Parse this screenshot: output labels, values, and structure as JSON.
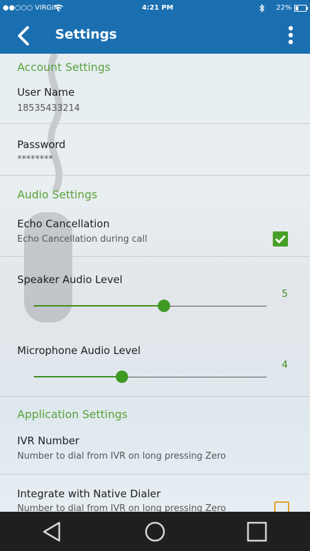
{
  "status": {
    "carrier": "●●○○○ VIRGIN",
    "time": "4:21 PM",
    "battery": "22%",
    "icons": [
      "wifi-icon",
      "bluetooth-icon",
      "battery-icon"
    ]
  },
  "appbar": {
    "title": "Settings",
    "back_icon": "arrow-back-icon",
    "menu_icon": "more-vert-icon"
  },
  "sections": {
    "account": "Account Settings",
    "audio": "Audio Settings",
    "application": "Application Settings"
  },
  "account": {
    "username_label": "User Name",
    "username_value": "18535433214",
    "password_label": "Password",
    "password_value": "********"
  },
  "audio": {
    "echo_label": "Echo Cancellation",
    "echo_sub": "Echo Cancellation during call",
    "echo_checked": true,
    "speaker_label": "Speaker Audio Level",
    "speaker_value": "5",
    "speaker_fraction": 0.56,
    "mic_label": "Microphone Audio Level",
    "mic_value": "4",
    "mic_fraction": 0.38
  },
  "application": {
    "ivr_label": "IVR Number",
    "ivr_sub": "Number to dial from IVR on long pressing Zero",
    "native_label": "Integrate with Native Dialer",
    "native_sub": "Number to dial from IVR on long pressing Zero",
    "native_checked": false
  },
  "colors": {
    "primary": "#1a6fb0",
    "accent": "#5aa23a",
    "checkbox_unchecked": "#e0a12a"
  },
  "navbar": {
    "icons": [
      "back-triangle-icon",
      "home-circle-icon",
      "recents-square-icon"
    ]
  }
}
